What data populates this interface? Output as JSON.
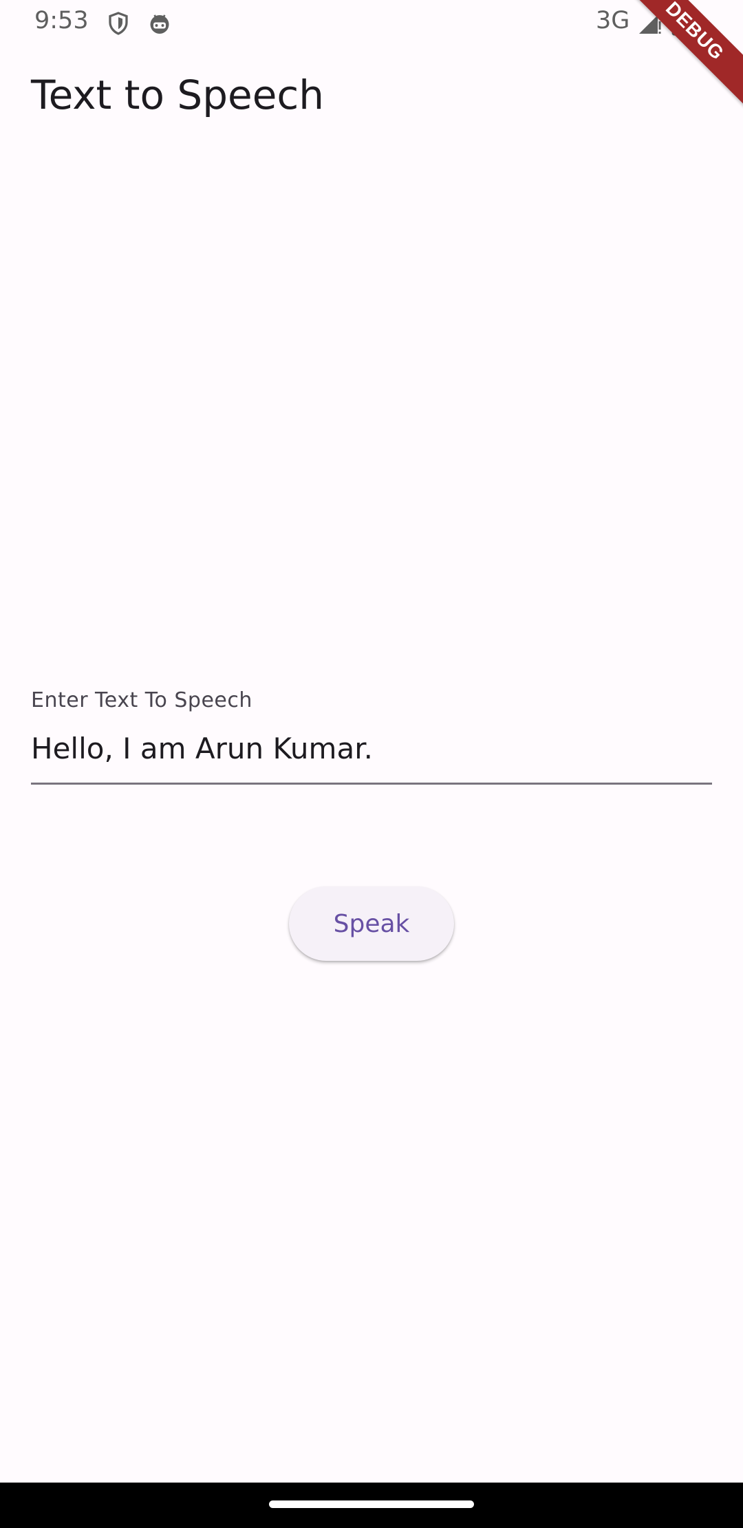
{
  "status_bar": {
    "time": "9:53",
    "network": "3G",
    "icons": [
      "shield-icon",
      "android-icon",
      "signal-icon",
      "battery-icon"
    ]
  },
  "debug_banner": {
    "label": "DEBUG"
  },
  "app_bar": {
    "title": "Text to Speech"
  },
  "text_field": {
    "label": "Enter Text To Speech",
    "value": "Hello, I am Arun Kumar."
  },
  "speak_button": {
    "label": "Speak"
  },
  "colors": {
    "background": "#fffbfe",
    "primary": "#6750a4",
    "button_bg": "#f6f1f8",
    "debug_banner": "#a02828",
    "underline": "#79747e"
  }
}
